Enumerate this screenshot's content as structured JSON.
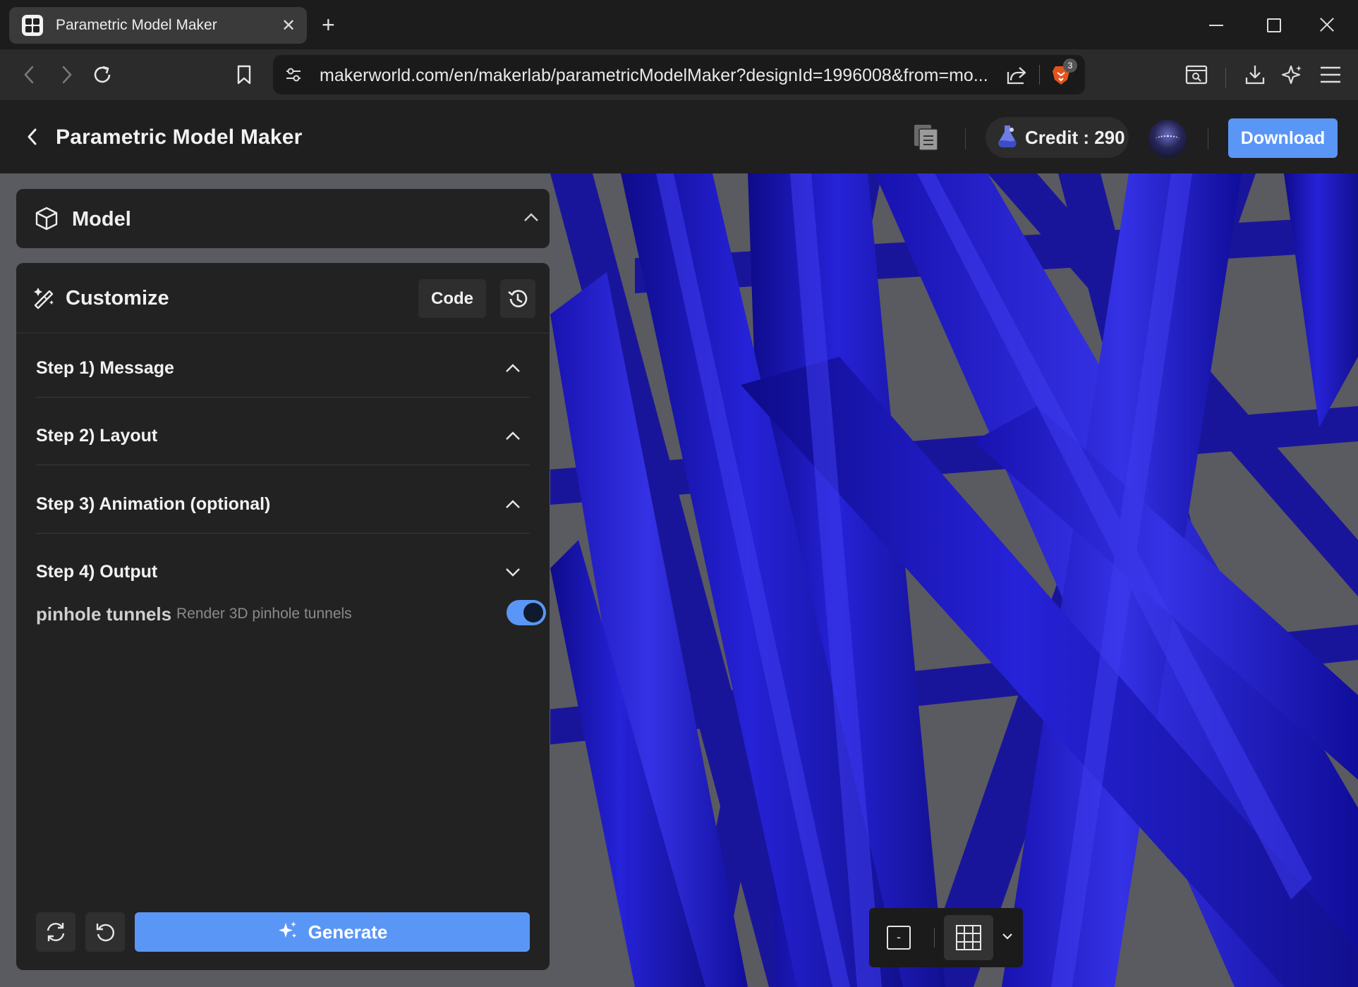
{
  "browser": {
    "tab_title": "Parametric Model Maker",
    "url": "makerworld.com/en/makerlab/parametricModelMaker?designId=1996008&from=mo...",
    "shields_count": "3"
  },
  "header": {
    "title": "Parametric Model Maker",
    "credit_label": "Credit : 290",
    "download_label": "Download"
  },
  "model_panel": {
    "title": "Model"
  },
  "customize": {
    "title": "Customize",
    "code_label": "Code",
    "steps": [
      {
        "label": "Step 1) Message",
        "state": "collapsed"
      },
      {
        "label": "Step 2) Layout",
        "state": "collapsed"
      },
      {
        "label": "Step 3) Animation (optional)",
        "state": "collapsed"
      },
      {
        "label": "Step 4) Output",
        "state": "expanded"
      }
    ],
    "param": {
      "name": "pinhole tunnels",
      "description": "Render 3D pinhole tunnels",
      "enabled": true
    },
    "generate_label": "Generate"
  },
  "viewport": {
    "minus_label": "-"
  },
  "colors": {
    "accent": "#5a96f5",
    "model_blue": "#1a16c8",
    "background": "#5c5c63"
  }
}
